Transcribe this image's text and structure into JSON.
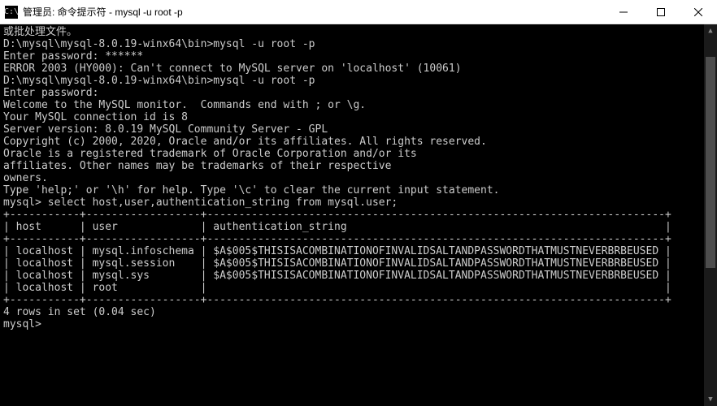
{
  "window": {
    "title": "管理员: 命令提示符 - mysql  -u root -p",
    "icon_label": "C:\\"
  },
  "terminal": {
    "lines": [
      "或批处理文件。",
      "",
      "D:\\mysql\\mysql-8.0.19-winx64\\bin>mysql -u root -p",
      "Enter password: ******",
      "ERROR 2003 (HY000): Can't connect to MySQL server on 'localhost' (10061)",
      "",
      "D:\\mysql\\mysql-8.0.19-winx64\\bin>mysql -u root -p",
      "Enter password:",
      "Welcome to the MySQL monitor.  Commands end with ; or \\g.",
      "Your MySQL connection id is 8",
      "Server version: 8.0.19 MySQL Community Server - GPL",
      "",
      "Copyright (c) 2000, 2020, Oracle and/or its affiliates. All rights reserved.",
      "",
      "Oracle is a registered trademark of Oracle Corporation and/or its",
      "affiliates. Other names may be trademarks of their respective",
      "owners.",
      "",
      "Type 'help;' or '\\h' for help. Type '\\c' to clear the current input statement.",
      "",
      "mysql> select host,user,authentication_string from mysql.user;"
    ],
    "table": {
      "divider": "+-----------+------------------+------------------------------------------------------------------------+",
      "header": "| host      | user             | authentication_string                                                  |",
      "rows": [
        "| localhost | mysql.infoschema | $A$005$THISISACOMBINATIONOFINVALIDSALTANDPASSWORDTHATMUSTNEVERBRBEUSED |",
        "| localhost | mysql.session    | $A$005$THISISACOMBINATIONOFINVALIDSALTANDPASSWORDTHATMUSTNEVERBRBEUSED |",
        "| localhost | mysql.sys        | $A$005$THISISACOMBINATIONOFINVALIDSALTANDPASSWORDTHATMUSTNEVERBRBEUSED |",
        "| localhost | root             |                                                                        |"
      ]
    },
    "footer": [
      "4 rows in set (0.04 sec)",
      "",
      "mysql>"
    ]
  },
  "chart_data": {
    "type": "table",
    "title": "mysql.user query result",
    "columns": [
      "host",
      "user",
      "authentication_string"
    ],
    "rows": [
      [
        "localhost",
        "mysql.infoschema",
        "$A$005$THISISACOMBINATIONOFINVALIDSALTANDPASSWORDTHATMUSTNEVERBRBEUSED"
      ],
      [
        "localhost",
        "mysql.session",
        "$A$005$THISISACOMBINATIONOFINVALIDSALTANDPASSWORDTHATMUSTNEVERBRBEUSED"
      ],
      [
        "localhost",
        "mysql.sys",
        "$A$005$THISISACOMBINATIONOFINVALIDSALTANDPASSWORDTHATMUSTNEVERBRBEUSED"
      ],
      [
        "localhost",
        "root",
        ""
      ]
    ],
    "row_count": 4,
    "elapsed_sec": 0.04
  }
}
